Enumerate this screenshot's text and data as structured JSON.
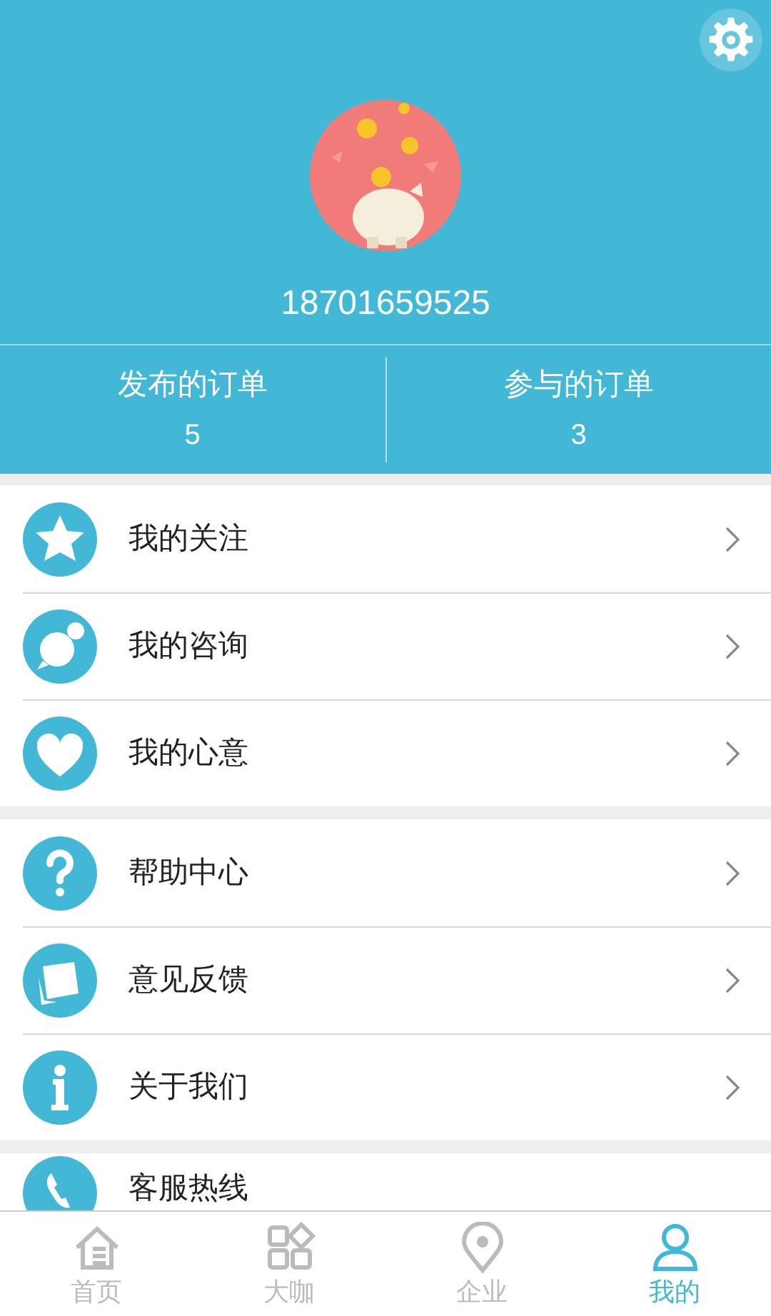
{
  "profile": {
    "phone": "18701659525"
  },
  "stats": [
    {
      "label": "发布的订单",
      "value": "5"
    },
    {
      "label": "参与的订单",
      "value": "3"
    }
  ],
  "menu_groups": [
    [
      {
        "label": "我的关注"
      },
      {
        "label": "我的咨询"
      },
      {
        "label": "我的心意"
      }
    ],
    [
      {
        "label": "帮助中心"
      },
      {
        "label": "意见反馈"
      },
      {
        "label": "关于我们"
      }
    ],
    [
      {
        "label": "客服热线"
      }
    ]
  ],
  "tab_bar": [
    {
      "label": "首页",
      "selected": false
    },
    {
      "label": "大咖",
      "selected": false
    },
    {
      "label": "企业",
      "selected": false
    },
    {
      "label": "我的",
      "selected": true
    }
  ]
}
